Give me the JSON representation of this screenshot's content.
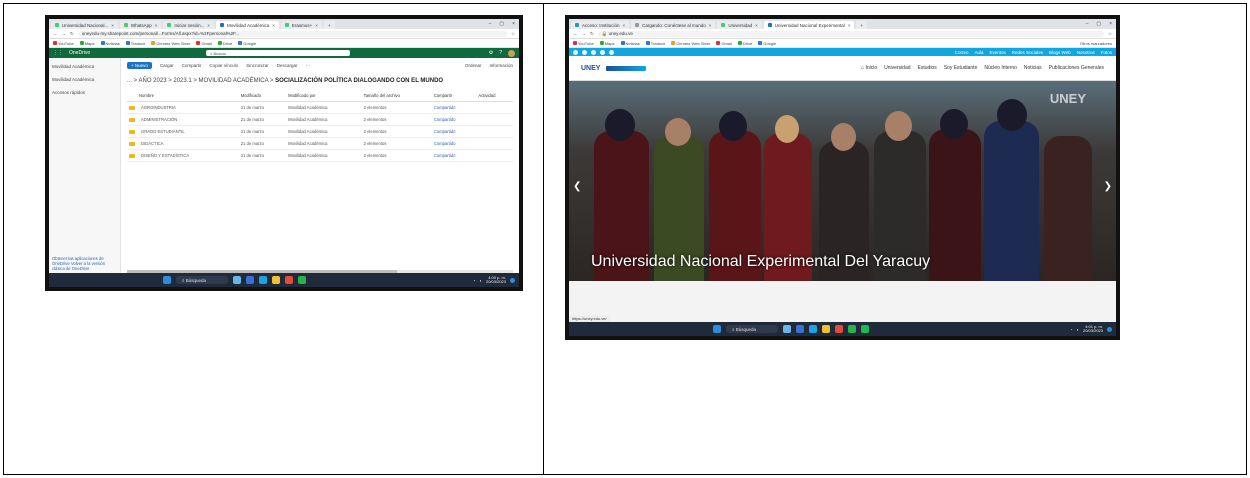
{
  "left": {
    "tabs": [
      "Universidad Nacional...",
      "WhatsApp",
      "Iniciar sesión...",
      "Movilidad Académica",
      "Erasmus+",
      "Nueva pestaña"
    ],
    "url": "uneyedu-my.sharepoint.com/personal/...Forms/All.aspx?id=%2Fpersonal%2F...",
    "bookmarks": [
      "YouTube",
      "Maps",
      "Noticias",
      "Traducir",
      "Chrome Web Store",
      "Gmail",
      "Drive",
      "Iniciar sesión",
      "Google"
    ],
    "app_name": "OneDrive",
    "search_placeholder": "Buscar",
    "sidebar": {
      "items": [
        "Movilidad Académica",
        "Movilidad Académica",
        "Accesos rápidos"
      ],
      "bottom": "Obtener las aplicaciones de OneDrive  Volver a la versión clásica de OneDrive"
    },
    "commands": [
      "+ Nuevo",
      "Cargar",
      "Compartir",
      "Copiar vínculo",
      "Sincronizar",
      "Descargar",
      "···",
      "Ordenar",
      "Información"
    ],
    "breadcrumb_prefix": "... > AÑO 2023 > 2023.1 > MOVILIDAD ACADÉMICA >",
    "breadcrumb_current": "SOCIALIZACIÓN POLÍTICA DIALOGANDO CON EL MUNDO",
    "columns": [
      "Nombre",
      "Modificado",
      "Modificado por",
      "Tamaño del archivo",
      "Compartir",
      "Actividad"
    ],
    "rows": [
      {
        "name": "AGROINDUSTRIA",
        "mod": "21 de marzo",
        "by": "Movilidad Académica",
        "size": "2 elementos",
        "share": "Compartido"
      },
      {
        "name": "ADMINISTRACIÓN",
        "mod": "21 de marzo",
        "by": "Movilidad Académica",
        "size": "2 elementos",
        "share": "Compartido"
      },
      {
        "name": "GRADO ESTUDIANTIL",
        "mod": "21 de marzo",
        "by": "Movilidad Académica",
        "size": "2 elementos",
        "share": "Compartido"
      },
      {
        "name": "DIDÁCTICA",
        "mod": "21 de marzo",
        "by": "Movilidad Académica",
        "size": "2 elementos",
        "share": "Compartido"
      },
      {
        "name": "DISEÑO Y ESTADÍSTICA",
        "mod": "21 de marzo",
        "by": "Movilidad Académica",
        "size": "2 elementos",
        "share": "Compartido"
      }
    ],
    "taskbar_search": "Búsqueda",
    "clock_time": "4:00 p. m.",
    "clock_date": "20/03/2023"
  },
  "right": {
    "tabs": [
      "Acceso: Institución",
      "Cargando: Conéctese al mundo",
      "Universidad",
      "Universidad Nacional Experimental"
    ],
    "url": "uney.edu.ve",
    "bookmarks": [
      "YouTube",
      "Maps",
      "Noticias",
      "Traducir",
      "Chrome Web Store",
      "Gmail",
      "Drive",
      "Iniciar sesión",
      "Google"
    ],
    "bookmarks_right": "Otros marcadores",
    "top_links": [
      "Correo",
      "Aula",
      "Eventos",
      "Redes Sociales",
      "Blogs Web",
      "Nosotros",
      "Fotos"
    ],
    "logo": "UNEY",
    "nav": [
      "Inicio",
      "Universidad",
      "Estudios",
      "Soy Estudiante",
      "Núcleo Interno",
      "Noticias",
      "Publicaciones Generales"
    ],
    "hero_banner": "UNEY",
    "hero_title": "Universidad Nacional Experimental Del Yaracuy",
    "status_url": "https://uney.edu.ve/",
    "taskbar_search": "Búsqueda",
    "clock_time": "4:01 p. m.",
    "clock_date": "20/03/2023"
  }
}
